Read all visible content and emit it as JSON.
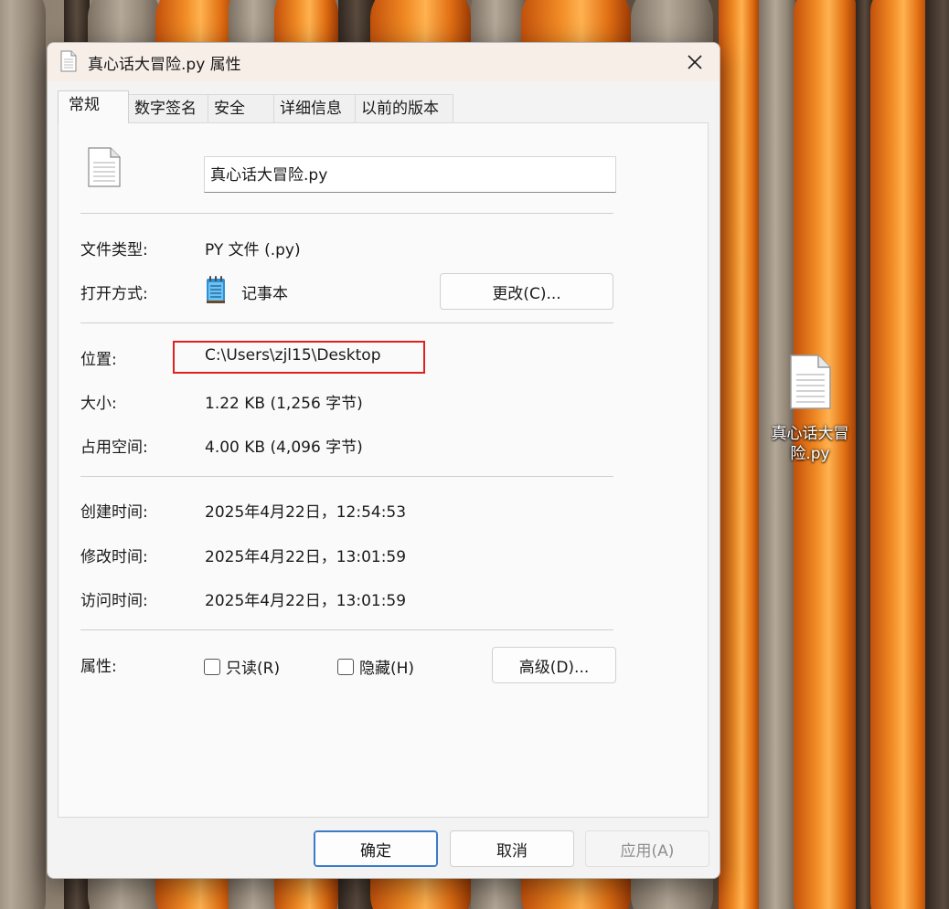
{
  "dialog": {
    "title": "真心话大冒险.py 属性",
    "tabs": [
      {
        "label": "常规",
        "active": true
      },
      {
        "label": "数字签名",
        "active": false
      },
      {
        "label": "安全",
        "active": false
      },
      {
        "label": "详细信息",
        "active": false
      },
      {
        "label": "以前的版本",
        "active": false
      }
    ],
    "general": {
      "file_name": "真心话大冒险.py",
      "file_type_label": "文件类型:",
      "file_type_value": "PY 文件 (.py)",
      "open_with_label": "打开方式:",
      "open_with_value": "记事本",
      "change_button": "更改(C)...",
      "location_label": "位置:",
      "location_value": "C:\\Users\\zjl15\\Desktop",
      "size_label": "大小:",
      "size_value": "1.22 KB (1,256 字节)",
      "disk_size_label": "占用空间:",
      "disk_size_value": "4.00 KB (4,096 字节)",
      "created_label": "创建时间:",
      "created_value": "2025年4月22日，12:54:53",
      "modified_label": "修改时间:",
      "modified_value": "2025年4月22日，13:01:59",
      "accessed_label": "访问时间:",
      "accessed_value": "2025年4月22日，13:01:59",
      "attributes_label": "属性:",
      "readonly_label": "只读(R)",
      "readonly_checked": false,
      "hidden_label": "隐藏(H)",
      "hidden_checked": false,
      "advanced_button": "高级(D)..."
    },
    "footer": {
      "ok": "确定",
      "cancel": "取消",
      "apply": "应用(A)"
    }
  },
  "desktop": {
    "icon_label": "真心话大冒险.py"
  },
  "colors": {
    "highlight": "#e02020",
    "primary_border": "#3b7ac9",
    "titlebar": "#f7eee7"
  }
}
